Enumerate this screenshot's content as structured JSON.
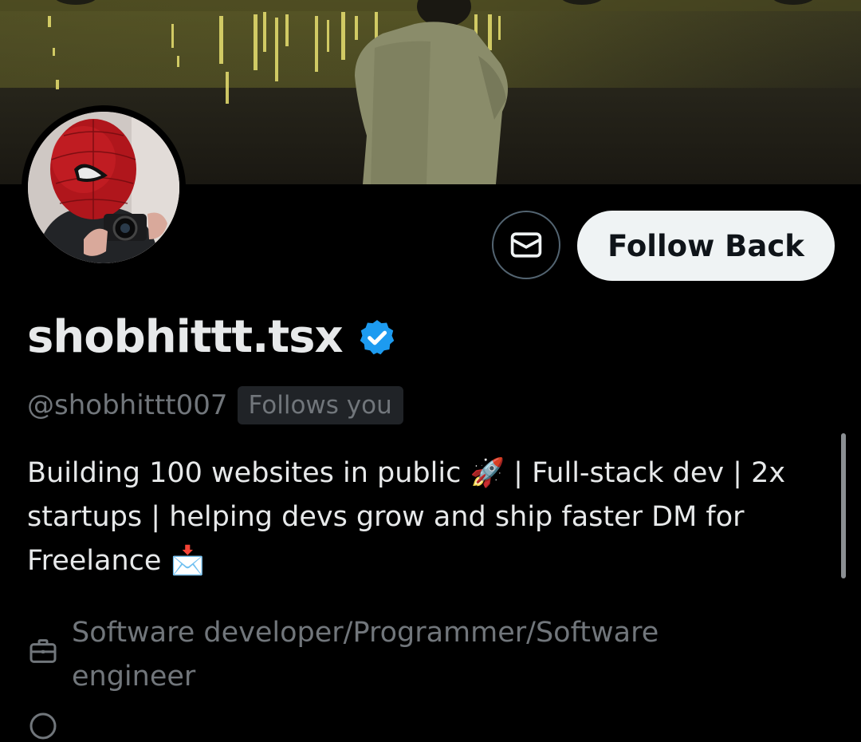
{
  "profile": {
    "display_name": "shobhittt.tsx",
    "handle": "@shobhittt007",
    "follows_you_label": "Follows you",
    "verified": true,
    "bio": "Building 100 websites in public 🚀 | Full-stack dev | 2x\nstartups | helping devs grow and ship faster  DM for\nFreelance 📩",
    "profession": "Software developer/Programmer/Software engineer"
  },
  "actions": {
    "message_icon": "envelope-icon",
    "follow_back_label": "Follow Back"
  },
  "colors": {
    "background": "#000000",
    "verified_blue": "#1d9bf0",
    "follow_button_bg": "#eff3f4",
    "muted_text": "#71767b"
  },
  "icons": {
    "verified": "verified-badge-icon",
    "profession": "briefcase-icon",
    "bottom_row": "partial-icon"
  }
}
